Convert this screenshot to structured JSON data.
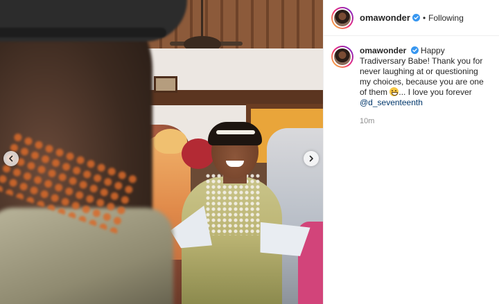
{
  "post": {
    "username": "omawonder",
    "follow_status": "Following",
    "separator": "•"
  },
  "caption": {
    "username": "omawonder",
    "text_before_emoji": "Happy Tradiversary Babe! Thank you for never laughing at or questioning my choices, because you are one of them",
    "text_after_emoji": "... I love you forever",
    "mention": "@d_seventeenth",
    "timestamp": "10m",
    "emoji": "grinning-face-emoji"
  },
  "icons": {
    "verified": "verified-badge-icon",
    "prev": "chevron-left-icon",
    "next": "chevron-right-icon"
  },
  "colors": {
    "verified_blue": "#3897f0",
    "mention": "#00376b",
    "timestamp": "#8e8e8e",
    "story_ring_start": "#f9ce34",
    "story_ring_end": "#6228d7"
  }
}
